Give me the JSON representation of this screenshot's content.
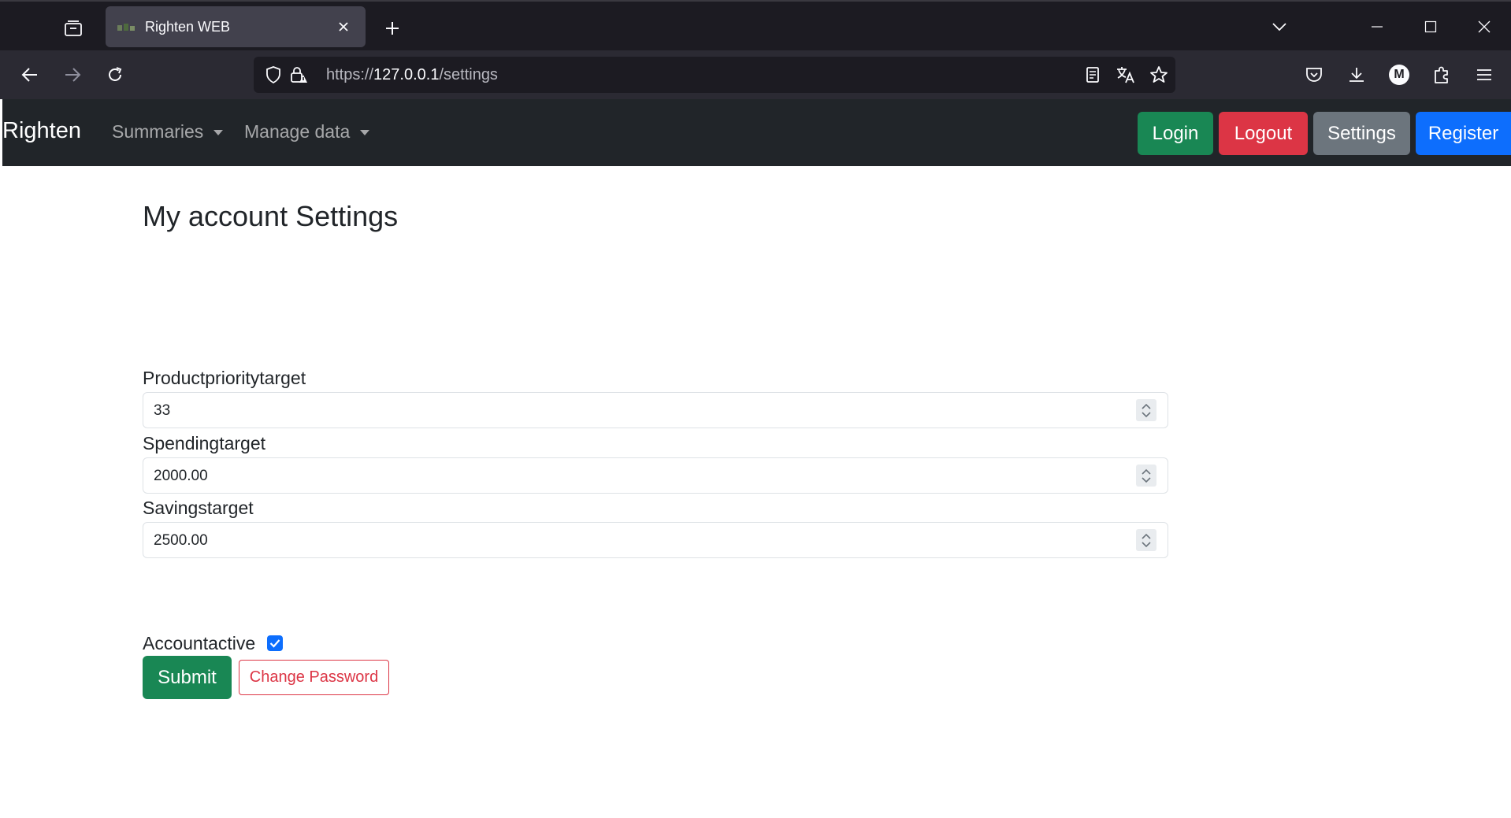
{
  "browser": {
    "tab_title": "Righten WEB",
    "url_scheme": "https://",
    "url_host": "127.0.0.1",
    "url_path": "/settings",
    "avatar_letter": "M"
  },
  "site": {
    "brand": "Righten",
    "menus": [
      {
        "label": "Summaries"
      },
      {
        "label": "Manage data"
      }
    ],
    "buttons": {
      "login": "Login",
      "logout": "Logout",
      "settings": "Settings",
      "register": "Register"
    }
  },
  "form": {
    "title": "My account Settings",
    "fields": [
      {
        "label": "Productprioritytarget",
        "value": "33"
      },
      {
        "label": "Spendingtarget",
        "value": "2000.00"
      },
      {
        "label": "Savingstarget",
        "value": "2500.00"
      }
    ],
    "checkbox_label": "Accountactive",
    "checkbox_checked": true,
    "submit_label": "Submit",
    "change_password_label": "Change Password"
  },
  "colors": {
    "success": "#198754",
    "danger": "#dc3545",
    "secondary": "#6c757d",
    "primary": "#0d6efd",
    "navbar": "#212529"
  }
}
